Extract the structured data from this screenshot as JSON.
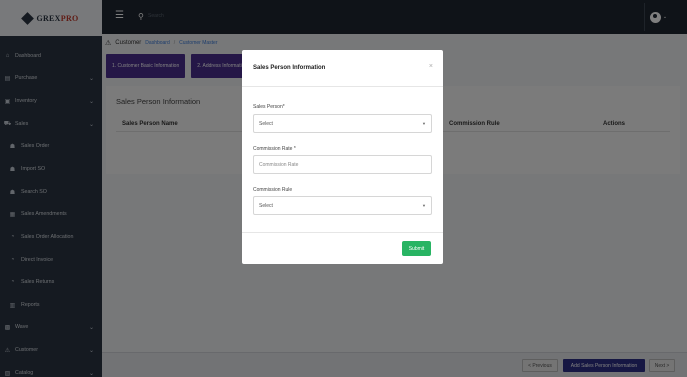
{
  "brand": {
    "name_main": "GREX",
    "name_accent": "PRO"
  },
  "sidebar": {
    "items": [
      {
        "label": "Dashboard",
        "icon": "home-icon",
        "glyph": "⌂",
        "has_chevron": false,
        "sub": false
      },
      {
        "label": "Purchase",
        "icon": "shop-icon",
        "glyph": "▤",
        "has_chevron": true,
        "sub": false
      },
      {
        "label": "Inventory",
        "icon": "box-icon",
        "glyph": "▣",
        "has_chevron": true,
        "sub": false
      },
      {
        "label": "Sales",
        "icon": "cart-icon",
        "glyph": "⛟",
        "has_chevron": true,
        "sub": false
      },
      {
        "label": "Sales Order",
        "icon": "people-icon",
        "glyph": "☗",
        "has_chevron": false,
        "sub": true
      },
      {
        "label": "Import SO",
        "icon": "people-icon",
        "glyph": "☗",
        "has_chevron": false,
        "sub": true
      },
      {
        "label": "Search SO",
        "icon": "people-icon",
        "glyph": "☗",
        "has_chevron": false,
        "sub": true
      },
      {
        "label": "Sales Amendments",
        "icon": "document-icon",
        "glyph": "▦",
        "has_chevron": false,
        "sub": true
      },
      {
        "label": "Sales Order Allocation",
        "icon": "circle-arrow-icon",
        "glyph": "◔",
        "has_chevron": false,
        "sub": true
      },
      {
        "label": "Direct Invoice",
        "icon": "circle-arrow-icon",
        "glyph": "◔",
        "has_chevron": false,
        "sub": true
      },
      {
        "label": "Sales Returns",
        "icon": "circle-arrow-icon",
        "glyph": "◔",
        "has_chevron": false,
        "sub": true
      },
      {
        "label": "Reports",
        "icon": "chart-icon",
        "glyph": "▥",
        "has_chevron": false,
        "sub": true
      },
      {
        "label": "Wave",
        "icon": "wave-icon",
        "glyph": "▩",
        "has_chevron": true,
        "sub": false
      },
      {
        "label": "Customer",
        "icon": "customer-icon",
        "glyph": "⚠",
        "has_chevron": true,
        "sub": false
      },
      {
        "label": "Catalog",
        "icon": "catalog-icon",
        "glyph": "▧",
        "has_chevron": true,
        "sub": false
      }
    ]
  },
  "topbar": {
    "search_placeholder": "Search"
  },
  "breadcrumb": {
    "title": "Customer",
    "links": [
      "Dashboard",
      "Customer Master"
    ],
    "separator": "/"
  },
  "steps": [
    "1. Customer Basic Information",
    "2. Address Information"
  ],
  "card": {
    "title": "Sales Person Information",
    "columns": [
      "Sales Person Name",
      "Commission Rule",
      "Actions"
    ]
  },
  "footer": {
    "prev_label": "< Previous",
    "add_label": "Add Sales Person Information",
    "next_label": "Next >"
  },
  "modal": {
    "title": "Sales Person Information",
    "close_glyph": "×",
    "sales_person_label": "Sales Person*",
    "sales_person_value": "Select",
    "commission_rate_label": "Commission Rate *",
    "commission_rate_placeholder": "Commission Rate",
    "commission_rule_label": "Commission Rule",
    "commission_rule_value": "Select",
    "submit_label": "Submit"
  },
  "colors": {
    "step_tab": "#4a2e8f",
    "submit": "#28b463",
    "add_button": "#2c2f87",
    "sidebar_bg": "#2b3542",
    "topbar_bg": "#1f2731"
  }
}
